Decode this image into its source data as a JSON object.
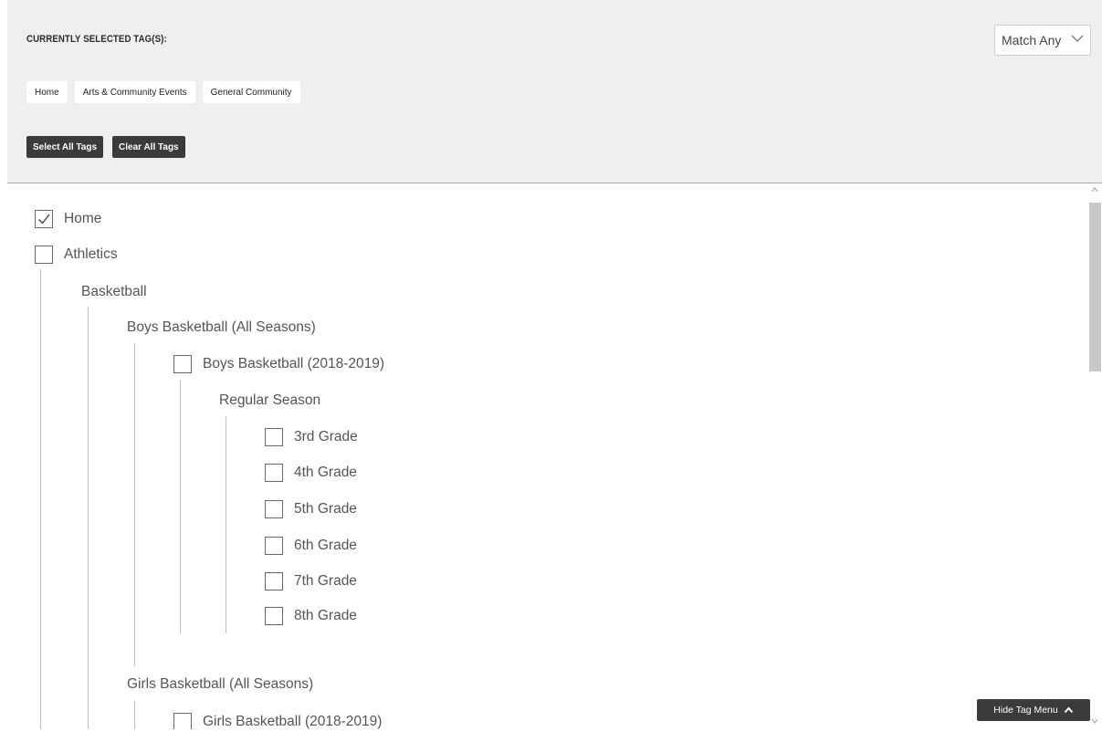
{
  "header": {
    "title": "CURRENTLY SELECTED TAG(S):",
    "match_value": "Match Any"
  },
  "selected_tags": [
    "Home",
    "Arts & Community Events",
    "General Community"
  ],
  "buttons": {
    "select_all": "Select All Tags",
    "clear_all": "Clear All Tags",
    "hide_menu": "Hide Tag Menu"
  },
  "tree": [
    {
      "label": "Home",
      "checkbox": true,
      "checked": true
    },
    {
      "label": "Athletics",
      "checkbox": true,
      "checked": false
    },
    {
      "label": "Basketball",
      "checkbox": false
    },
    {
      "label": "Boys Basketball (All Seasons)",
      "checkbox": false
    },
    {
      "label": "Boys Basketball (2018-2019)",
      "checkbox": true,
      "checked": false
    },
    {
      "label": "Regular Season",
      "checkbox": false
    },
    {
      "label": "3rd Grade",
      "checkbox": true,
      "checked": false
    },
    {
      "label": "4th Grade",
      "checkbox": true,
      "checked": false
    },
    {
      "label": "5th Grade",
      "checkbox": true,
      "checked": false
    },
    {
      "label": "6th Grade",
      "checkbox": true,
      "checked": false
    },
    {
      "label": "7th Grade",
      "checkbox": true,
      "checked": false
    },
    {
      "label": "8th Grade",
      "checkbox": true,
      "checked": false
    },
    {
      "label": "Girls Basketball (All Seasons)",
      "checkbox": false
    },
    {
      "label": "Girls Basketball (2018-2019)",
      "checkbox": true,
      "checked": false
    }
  ],
  "icons": {
    "match_dropdown": "chevron-down-icon",
    "checkbox_checked": "checkmark-icon",
    "hide_menu": "chevron-up-icon",
    "scroll_up": "scroll-up-arrow-icon",
    "scroll_down": "scroll-down-arrow-icon"
  }
}
